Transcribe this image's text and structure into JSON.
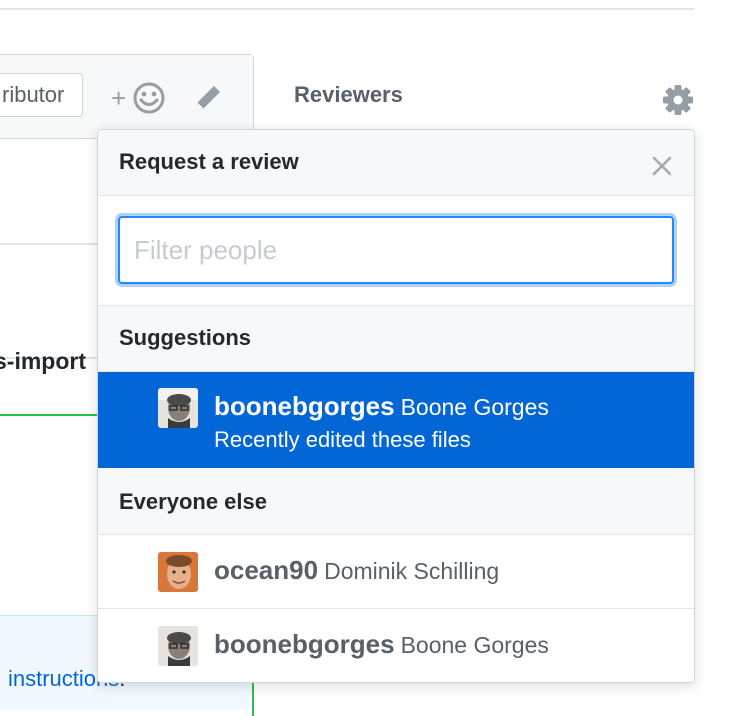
{
  "background": {
    "role_badge": "ributor",
    "file_name": "s-import",
    "instructions_link": "instructions",
    "instructions_suffix": "."
  },
  "sidebar": {
    "title": "Reviewers"
  },
  "popover": {
    "title": "Request a review",
    "filter": {
      "value": "",
      "placeholder": "Filter people"
    },
    "suggestions_label": "Suggestions",
    "suggestions": [
      {
        "login": "boonebgorges",
        "name": "Boone Gorges",
        "reason": "Recently edited these files",
        "selected": true
      }
    ],
    "everyone_label": "Everyone else",
    "everyone": [
      {
        "login": "ocean90",
        "name": "Dominik Schilling"
      },
      {
        "login": "boonebgorges",
        "name": "Boone Gorges"
      }
    ]
  },
  "icons": [
    "smiley-icon",
    "pencil-icon",
    "gear-icon",
    "close-icon"
  ],
  "colors": {
    "selected_bg": "#0366d6",
    "focus_border": "#2188ff",
    "header_bg": "#f6f8fa",
    "link": "#0366d6",
    "added_line": "#2cbe4e"
  }
}
